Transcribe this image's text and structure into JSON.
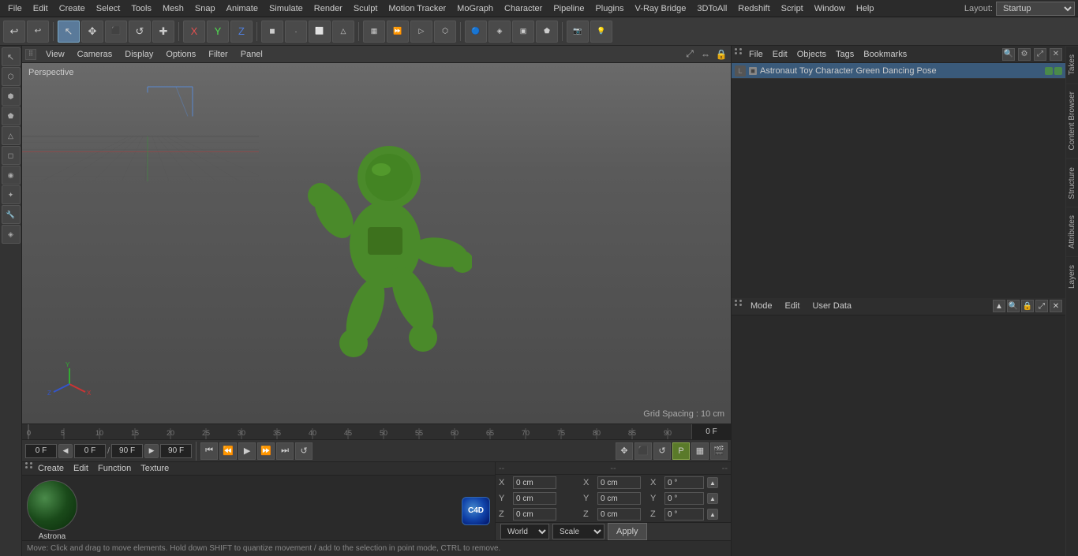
{
  "menubar": {
    "items": [
      "File",
      "Edit",
      "Create",
      "Select",
      "Tools",
      "Mesh",
      "Snap",
      "Animate",
      "Simulate",
      "Render",
      "Sculpt",
      "Motion Tracker",
      "MoGraph",
      "Character",
      "Pipeline",
      "Plugins",
      "V-Ray Bridge",
      "3DToAll",
      "Redshift",
      "Script",
      "Window",
      "Help"
    ],
    "layout_label": "Layout:",
    "layout_value": "Startup"
  },
  "toolbar": {
    "buttons": [
      "↩",
      "⟳",
      "↖",
      "✥",
      "⬛",
      "↺",
      "✚",
      "X",
      "Y",
      "Z",
      "◼",
      "⬜",
      "⟲",
      "▶",
      "▷",
      "⬡",
      "⬣",
      "△",
      "⏩",
      "▦",
      "☁",
      "🔵",
      "◈",
      "▣",
      "⬟",
      "📷",
      "💡"
    ]
  },
  "left_sidebar": {
    "buttons": [
      "↖",
      "⬡",
      "⬢",
      "⬟",
      "△",
      "◻",
      "⬠",
      "🔧",
      "✂",
      "◈"
    ]
  },
  "viewport": {
    "label": "Perspective",
    "menu_items": [
      "View",
      "Cameras",
      "Display",
      "Options",
      "Filter",
      "Panel"
    ],
    "grid_spacing": "Grid Spacing : 10 cm"
  },
  "timeline": {
    "ticks": [
      0,
      5,
      10,
      15,
      20,
      25,
      30,
      35,
      40,
      45,
      50,
      55,
      60,
      65,
      70,
      75,
      80,
      85,
      90
    ],
    "current_frame": "0 F",
    "frame_display": "0 F"
  },
  "playback": {
    "start_frame": "0 F",
    "current_frame": "0 F",
    "end_frame": "90 F",
    "total_frames": "90 F",
    "buttons": [
      "⏮",
      "⏪",
      "▶",
      "⏩",
      "⏭",
      "⟲"
    ]
  },
  "right_panel": {
    "objects_header_items": [
      "File",
      "Edit",
      "Objects",
      "Tags",
      "Bookmarks"
    ],
    "object": {
      "name": "Astronaut Toy Character Green Dancing Pose",
      "icon_color": "#4a8a4a"
    },
    "attrs_header_items": [
      "Mode",
      "Edit",
      "User Data"
    ],
    "coords": {
      "pos_x": "0 cm",
      "pos_y": "0 cm",
      "pos_z": "0 cm",
      "rot_x": "0 °",
      "rot_y": "0 °",
      "rot_z": "0 °",
      "scale_x": "0 cm",
      "scale_y": "0 cm",
      "scale_z": "0 cm"
    },
    "side_tabs": [
      "Takes",
      "Content Browser",
      "Structure",
      "Attributes",
      "Layers"
    ]
  },
  "bottom_bar": {
    "x_pos": "0 cm",
    "y_pos": "0 cm",
    "z_pos": "0 cm",
    "x_rot": "0 °",
    "world_label": "World",
    "scale_label": "Scale",
    "apply_label": "Apply",
    "dash1": "--",
    "dash2": "--",
    "dash3": "--"
  },
  "status_bar": {
    "text": "Move: Click and drag to move elements. Hold down SHIFT to quantize movement / add to the selection in point mode, CTRL to remove."
  },
  "material": {
    "name": "Astrona"
  },
  "mat_header": {
    "items": [
      "Create",
      "Edit",
      "Function",
      "Texture"
    ]
  }
}
